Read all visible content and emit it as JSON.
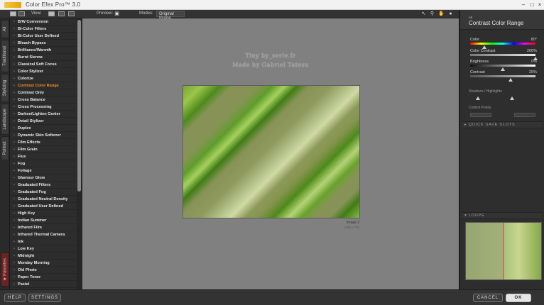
{
  "window": {
    "title": "Color Efex Pro™ 3.0",
    "controls": [
      "–",
      "□",
      "×"
    ]
  },
  "toolbar": {
    "view_label": "View:",
    "preview_label": "Preview:",
    "modes_label": "Modes:",
    "mode_value": "Original Image"
  },
  "left_tabs": [
    "All",
    "Traditional",
    "Stylizing",
    "Landscape",
    "Portrait",
    "★ Favorites"
  ],
  "filters": {
    "selected": "Contrast Color Range",
    "items": [
      "B/W Conversion",
      "Bi-Color Filters",
      "Bi-Color User Defined",
      "Bleach Bypass",
      "Brilliance/Warmth",
      "Burnt Sienna",
      "Classical Soft Focus",
      "Color Stylizer",
      "Colorize",
      "Contrast Color Range",
      "Contrast Only",
      "Cross Balance",
      "Cross Processing",
      "Darken/Lighten Center",
      "Detail Stylizer",
      "Duplex",
      "Dynamic Skin Softener",
      "Film Effects",
      "Film Grain",
      "Flux",
      "Fog",
      "Foliage",
      "Glamour Glow",
      "Graduated Filters",
      "Graduated Fog",
      "Graduated Neutral Density",
      "Graduated User Defined",
      "High Key",
      "Indian Summer",
      "Infrared Film",
      "Infrared Thermal Camera",
      "Ink",
      "Low Key",
      "Midnight",
      "Monday Morning",
      "Old Photo",
      "Paper Toner",
      "Pastel"
    ]
  },
  "canvas": {
    "watermark_line1": "Tiny by_serie.fr",
    "watermark_line2": "Made by Gabriel Tatesu",
    "image_label": "Image 2",
    "image_size": "1280 x 720"
  },
  "panel": {
    "category": "All",
    "filter_title": "Contrast Color Range",
    "controls": [
      {
        "label": "Color",
        "value": "80°",
        "fraction": 0.22
      },
      {
        "label": "Color Contrast",
        "value": "200%",
        "fraction": 1.0
      },
      {
        "label": "Brightness",
        "value": "0%",
        "fraction": 0.5
      },
      {
        "label": "Contrast",
        "value": "25%",
        "fraction": 0.62
      }
    ],
    "shadows_highlights": "Shadows / Highlights",
    "control_points": "Control Points",
    "quick_save": "▸ QUICK SAVE SLOTS",
    "loupe": "▾ LOUPE"
  },
  "footer": {
    "help": "HELP",
    "settings": "SETTINGS",
    "cancel": "CANCEL",
    "ok": "OK"
  },
  "colors": {
    "selected_filter": "#f08a24",
    "favorites_tab": "#6b2323"
  }
}
